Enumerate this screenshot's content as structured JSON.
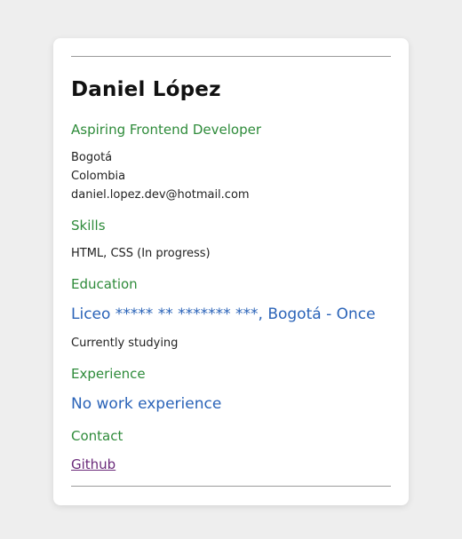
{
  "profile": {
    "name": "Daniel López",
    "role": "Aspiring Frontend Developer",
    "city": "Bogotá",
    "country": "Colombia",
    "email": "daniel.lopez.dev@hotmail.com"
  },
  "skills": {
    "heading": "Skills",
    "value": "HTML, CSS (In progress)"
  },
  "education": {
    "heading": "Education",
    "school": "Liceo ***** ** ******* ***, Bogotá - Once",
    "status": "Currently studying"
  },
  "experience": {
    "heading": "Experience",
    "value": "No work experience"
  },
  "contact": {
    "heading": "Contact",
    "github_label": "Github"
  },
  "colors": {
    "section_heading": "#2e8b3a",
    "highlight_blue": "#2a63b8",
    "visited_link": "#6a2a7a"
  }
}
